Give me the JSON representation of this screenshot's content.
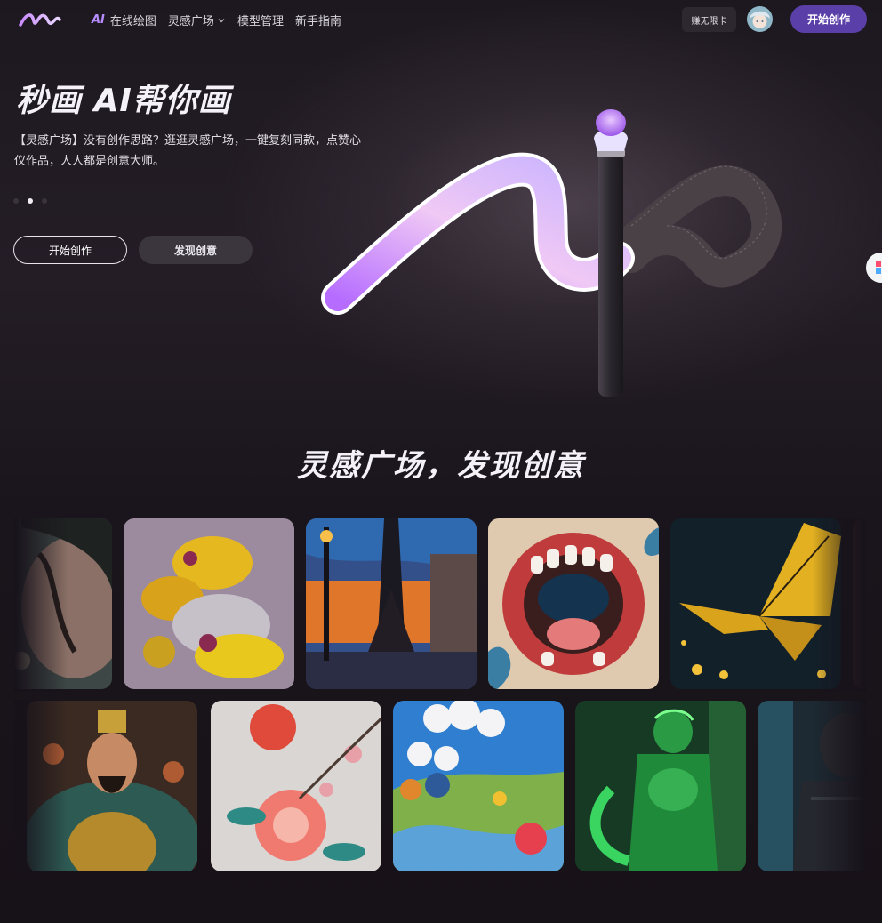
{
  "header": {
    "nav": [
      {
        "prefix": "AI",
        "label": "在线绘图"
      },
      {
        "label": "灵感广场"
      },
      {
        "label": "模型管理"
      },
      {
        "label": "新手指南"
      }
    ],
    "free_card": "赚无限卡",
    "start_button": "开始创作"
  },
  "hero": {
    "title": "秒画 AI帮你画",
    "description": "【灵感广场】没有创作思路？逛逛灵感广场，一键复刻同款，点赞心仪作品，人人都是创意大师。",
    "carousel": {
      "count": 3,
      "active": 2
    },
    "primary_button": "开始创作",
    "secondary_button": "发现创意"
  },
  "gallery": {
    "title": "灵感广场，发现创意",
    "row1": [
      "portrait-woman",
      "orchid-flowers",
      "eiffel-tower-painting",
      "dragon-mouth",
      "yellow-butterfly"
    ],
    "row2": [
      "emperor-portrait",
      "embroidered-flowers",
      "clay-landscape",
      "green-armor-warrior",
      "dark-creature"
    ]
  },
  "colors": {
    "accent": "#5b3fa8",
    "brand_purple": "#b68cff"
  }
}
